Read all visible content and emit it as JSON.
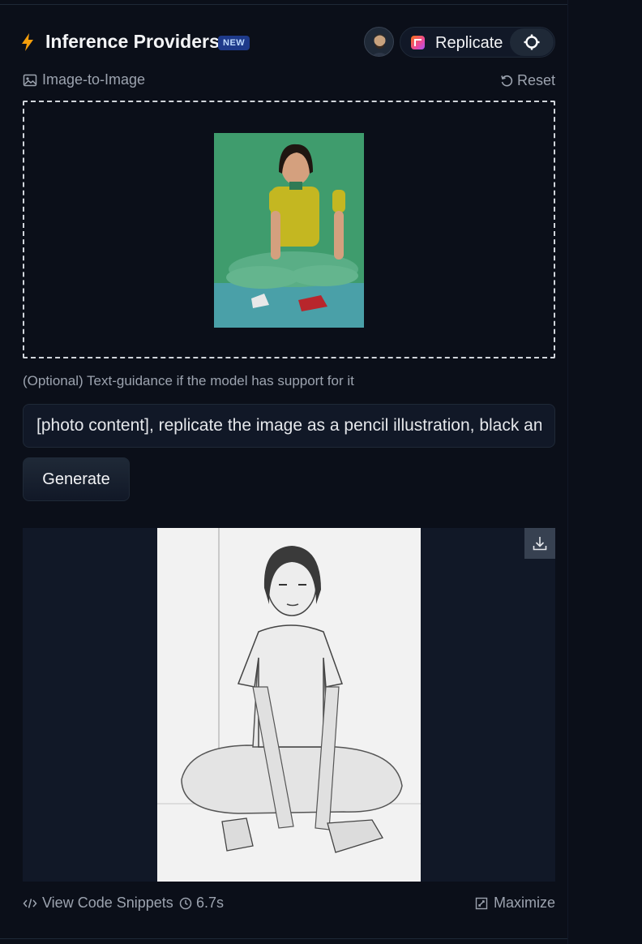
{
  "header": {
    "title": "Inference Providers",
    "badge": "NEW",
    "provider": {
      "name": "Replicate",
      "logo_icon": "replicate-logo-icon"
    },
    "settings_icon": "settings-icon"
  },
  "task": {
    "label": "Image-to-Image",
    "reset_label": "Reset"
  },
  "input": {
    "guidance_label": "(Optional) Text-guidance if the model has support for it",
    "prompt_value": "[photo content], replicate the image as a pencil illustration, black and white"
  },
  "actions": {
    "generate_label": "Generate"
  },
  "footer": {
    "snippets_label": "View Code Snippets",
    "timing": "6.7s",
    "maximize_label": "Maximize"
  },
  "colors": {
    "background": "#0b0f19",
    "accent": "#f59e0b",
    "badge": "#1e3a8a"
  }
}
